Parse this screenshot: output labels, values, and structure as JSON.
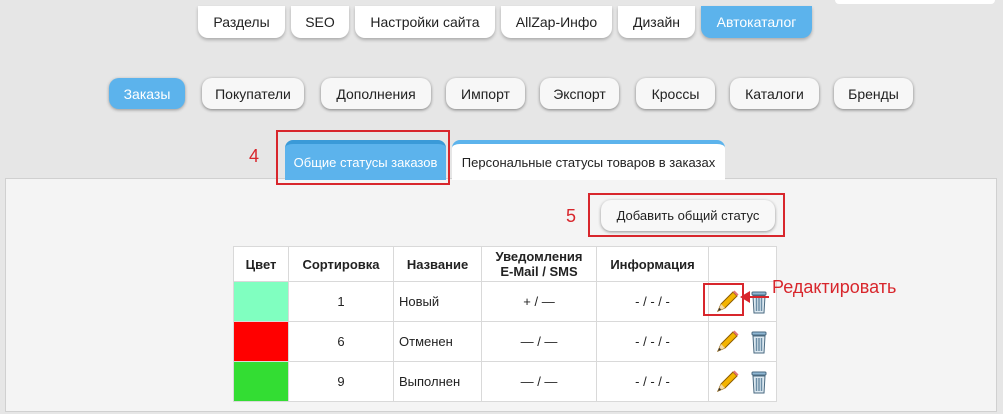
{
  "top_nav": {
    "items": [
      {
        "label": "Разделы"
      },
      {
        "label": "SEO"
      },
      {
        "label": "Настройки сайта"
      },
      {
        "label": "AllZap-Инфо"
      },
      {
        "label": "Дизайн"
      },
      {
        "label": "Автокаталог",
        "active": true
      }
    ]
  },
  "sub_nav": {
    "items": [
      {
        "label": "Заказы",
        "active": true
      },
      {
        "label": "Покупатели"
      },
      {
        "label": "Дополнения"
      },
      {
        "label": "Импорт"
      },
      {
        "label": "Экспорт"
      },
      {
        "label": "Кроссы"
      },
      {
        "label": "Каталоги"
      },
      {
        "label": "Бренды"
      }
    ]
  },
  "status_tabs": [
    {
      "label": "Общие статусы заказов",
      "active": true
    },
    {
      "label": "Персональные статусы товаров в заказах"
    }
  ],
  "add_button_label": "Добавить общий статус",
  "annotations": {
    "step4": "4",
    "step5": "5",
    "edit_label": "Редактировать"
  },
  "table": {
    "headers": [
      "Цвет",
      "Сортировка",
      "Название",
      "Уведомления\nE-Mail / SMS",
      "Информация",
      ""
    ],
    "header_notify_line1": "Уведомления",
    "header_notify_line2": "E-Mail / SMS",
    "rows": [
      {
        "color": "#80ffc0",
        "sort": "1",
        "name": "Новый",
        "notify": "+ / —",
        "info": "- / - / -"
      },
      {
        "color": "#ff0000",
        "sort": "6",
        "name": "Отменен",
        "notify": "— / —",
        "info": "- / - / -"
      },
      {
        "color": "#33dd33",
        "sort": "9",
        "name": "Выполнен",
        "notify": "— / —",
        "info": "- / - / -"
      }
    ]
  },
  "colors": {
    "accent": "#5cb3ec",
    "annotation_red": "#d8262c"
  },
  "icons": {
    "edit": "pencil-icon",
    "delete": "trash-icon"
  }
}
